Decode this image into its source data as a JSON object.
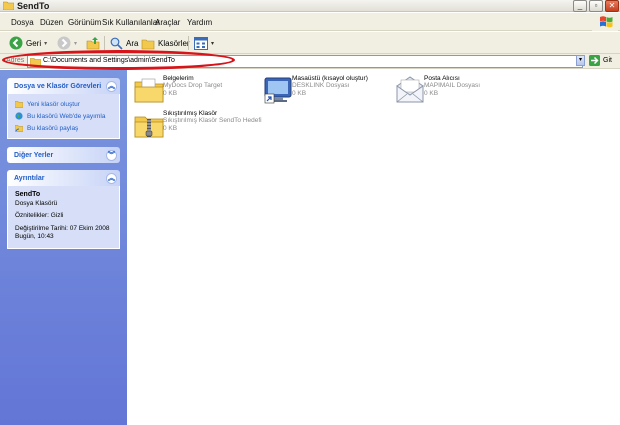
{
  "window": {
    "title": "SendTo"
  },
  "menu": [
    "Dosya",
    "Düzen",
    "Görünüm",
    "Sık Kullanılanlar",
    "Araçlar",
    "Yardım"
  ],
  "toolbar": {
    "back": "Geri",
    "search": "Ara",
    "folders": "Klasörler"
  },
  "address": {
    "label": "Adres",
    "path": "C:\\Documents and Settings\\admin\\SendTo",
    "go": "Git"
  },
  "tasks_panel": {
    "title": "Dosya ve Klasör Görevleri",
    "items": [
      "Yeni klasör oluştur",
      "Bu klasörü Web'de yayımla",
      "Bu klasörü paylaş"
    ]
  },
  "other_places": {
    "title": "Diğer Yerler"
  },
  "details": {
    "title": "Ayrıntılar",
    "name": "SendTo",
    "type": "Dosya Klasörü",
    "attributes": "Öznitelikler: Gizli",
    "modified_label": "Değiştirilme Tarihi: 07 Ekim 2008",
    "modified_time": "Bugün, 10:43"
  },
  "files": [
    {
      "name": "Belgelerim",
      "desc": "MyDocs Drop Target",
      "size": "0 KB",
      "icon": "my-documents-icon"
    },
    {
      "name": "Masaüstü (kısayol oluştur)",
      "desc": "DESKLINK Dosyası",
      "size": "0 KB",
      "icon": "desktop-shortcut-icon"
    },
    {
      "name": "Posta Alıcısı",
      "desc": "MAPIMAIL Dosyası",
      "size": "0 KB",
      "icon": "mail-recipient-icon"
    },
    {
      "name": "Sıkıştırılmış Klasör",
      "desc": "Sıkıştırılmış Klasör SendTo Hedefi",
      "size": "0 KB",
      "icon": "zip-folder-icon"
    }
  ],
  "colors": {
    "highlight": "#d6141a",
    "link": "#215dc6",
    "sidebar": "#6f87db"
  }
}
